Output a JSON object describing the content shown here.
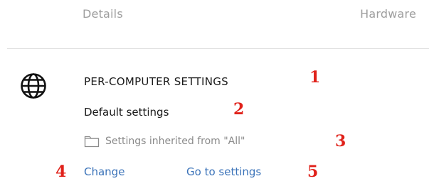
{
  "tabs": {
    "details_label": "Details",
    "hardware_label": "Hardware"
  },
  "settings": {
    "section_title": "PER-COMPUTER SETTINGS",
    "name": "Default settings",
    "inherited_text": "Settings inherited from \"All\""
  },
  "actions": {
    "change_label": "Change",
    "goto_label": "Go to settings"
  },
  "annotations": {
    "m1": "1",
    "m2": "2",
    "m3": "3",
    "m4": "4",
    "m5": "5"
  },
  "icons": {
    "globe": "globe-icon",
    "folder": "folder-icon"
  },
  "colors": {
    "link": "#3b73b9",
    "marker": "#e0211a",
    "muted": "#8a8a8a"
  }
}
